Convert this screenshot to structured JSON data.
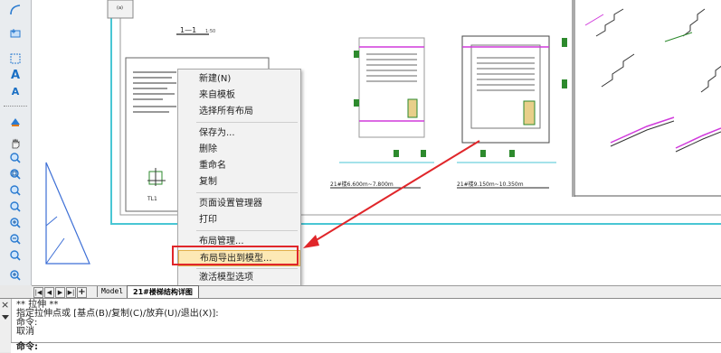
{
  "toolbar": {
    "icons": [
      "letter-a-icon",
      "letter-a-small-icon"
    ],
    "glyph_a": "A",
    "glyph_a_small": "A"
  },
  "drawing": {
    "title_1": "1—1",
    "title_1_scale": "1:50",
    "caption_left": "21#楼6.600m~7.800m",
    "caption_right": "21#楼9.150m~10.350m",
    "small_label": "TL1"
  },
  "context_menu": {
    "items": [
      {
        "label": "新建(N)"
      },
      {
        "label": "来自模板"
      },
      {
        "label": "选择所有布局"
      },
      {
        "label": "保存为..."
      },
      {
        "label": "删除"
      },
      {
        "label": "重命名"
      },
      {
        "label": "复制"
      },
      {
        "label": "页面设置管理器"
      },
      {
        "label": "打印"
      },
      {
        "label": "布局管理..."
      },
      {
        "label": "布局导出到模型..."
      },
      {
        "label": "激活模型选项"
      }
    ],
    "highlight_color": "#fde9b5",
    "annotation_color": "#e0262a"
  },
  "tabs": {
    "model": "Model",
    "layout": "21#楼梯结构详图"
  },
  "command": {
    "lines": [
      "** 拉伸 **",
      "指定拉伸点或 [基点(B)/复制(C)/放弃(U)/退出(X)]:",
      "命令:",
      "取消",
      "命令:"
    ],
    "close_glyph": "×"
  }
}
